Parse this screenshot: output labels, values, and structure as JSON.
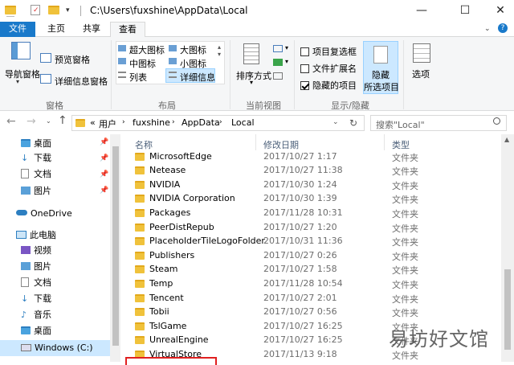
{
  "window": {
    "title": "C:\\Users\\fuxshine\\AppData\\Local",
    "controls": [
      "—",
      "☐",
      "✕"
    ]
  },
  "tabs": [
    {
      "label": "文件"
    },
    {
      "label": "主页"
    },
    {
      "label": "共享"
    },
    {
      "label": "查看"
    }
  ],
  "ribbon": {
    "nav_pane": "导航窗格",
    "preview_pane": "预览窗格",
    "details_pane": "详细信息窗格",
    "panes_group": "窗格",
    "layout": [
      "超大图标",
      "大图标",
      "中图标",
      "小图标",
      "列表",
      "详细信息"
    ],
    "layout_group": "布局",
    "sort_by": "排序方式",
    "current_view_group": "当前视图",
    "item_checkboxes": "项目复选框",
    "file_extensions": "文件扩展名",
    "hidden_items": "隐藏的项目",
    "hide_selected_1": "隐藏",
    "hide_selected_2": "所选项目",
    "show_hide_group": "显示/隐藏",
    "options": "选项"
  },
  "address": {
    "prefix": "«",
    "crumbs": [
      "用户",
      "fuxshine",
      "AppData",
      "Local"
    ],
    "search_placeholder": "搜索\"Local\""
  },
  "nav": [
    {
      "label": "桌面",
      "pinned": true
    },
    {
      "label": "下载",
      "pinned": true
    },
    {
      "label": "文档",
      "pinned": true
    },
    {
      "label": "图片",
      "pinned": true
    },
    {
      "label": "OneDrive"
    },
    {
      "label": "此电脑"
    },
    {
      "label": "视频"
    },
    {
      "label": "图片"
    },
    {
      "label": "文档"
    },
    {
      "label": "下载"
    },
    {
      "label": "音乐"
    },
    {
      "label": "桌面"
    },
    {
      "label": "Windows (C:)"
    }
  ],
  "columns": {
    "name": "名称",
    "date": "修改日期",
    "type": "类型"
  },
  "files": [
    {
      "name": "MicrosoftEdge",
      "date": "2017/10/27 1:17",
      "type": "文件夹"
    },
    {
      "name": "Netease",
      "date": "2017/10/27 11:38",
      "type": "文件夹"
    },
    {
      "name": "NVIDIA",
      "date": "2017/10/30 1:24",
      "type": "文件夹"
    },
    {
      "name": "NVIDIA Corporation",
      "date": "2017/10/30 1:39",
      "type": "文件夹"
    },
    {
      "name": "Packages",
      "date": "2017/11/28 10:31",
      "type": "文件夹"
    },
    {
      "name": "PeerDistRepub",
      "date": "2017/10/27 1:20",
      "type": "文件夹"
    },
    {
      "name": "PlaceholderTileLogoFolder",
      "date": "2017/10/31 11:36",
      "type": "文件夹"
    },
    {
      "name": "Publishers",
      "date": "2017/10/27 0:26",
      "type": "文件夹"
    },
    {
      "name": "Steam",
      "date": "2017/10/27 1:58",
      "type": "文件夹"
    },
    {
      "name": "Temp",
      "date": "2017/11/28 10:54",
      "type": "文件夹"
    },
    {
      "name": "Tencent",
      "date": "2017/10/27 2:01",
      "type": "文件夹"
    },
    {
      "name": "Tobii",
      "date": "2017/10/27 0:56",
      "type": "文件夹"
    },
    {
      "name": "TslGame",
      "date": "2017/10/27 16:25",
      "type": "文件夹"
    },
    {
      "name": "UnrealEngine",
      "date": "2017/10/27 16:25",
      "type": "文件夹"
    },
    {
      "name": "VirtualStore",
      "date": "2017/11/13 9:18",
      "type": "文件夹"
    }
  ],
  "watermark": "易坊好文馆",
  "colors": {
    "accent": "#1979ca",
    "folder": "#f0c23b",
    "selection": "#cce8ff",
    "highlight_box": "#e02020"
  }
}
